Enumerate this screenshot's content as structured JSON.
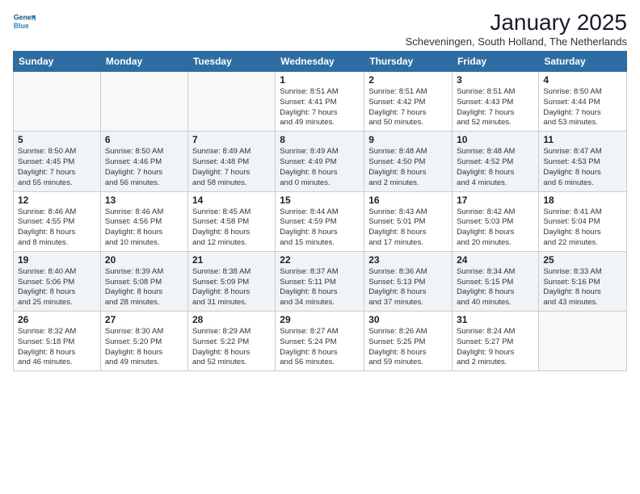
{
  "header": {
    "title": "January 2025",
    "subtitle": "Scheveningen, South Holland, The Netherlands",
    "logo_line1": "General",
    "logo_line2": "Blue"
  },
  "weekdays": [
    "Sunday",
    "Monday",
    "Tuesday",
    "Wednesday",
    "Thursday",
    "Friday",
    "Saturday"
  ],
  "weeks": [
    [
      {
        "day": "",
        "info": ""
      },
      {
        "day": "",
        "info": ""
      },
      {
        "day": "",
        "info": ""
      },
      {
        "day": "1",
        "info": "Sunrise: 8:51 AM\nSunset: 4:41 PM\nDaylight: 7 hours\nand 49 minutes."
      },
      {
        "day": "2",
        "info": "Sunrise: 8:51 AM\nSunset: 4:42 PM\nDaylight: 7 hours\nand 50 minutes."
      },
      {
        "day": "3",
        "info": "Sunrise: 8:51 AM\nSunset: 4:43 PM\nDaylight: 7 hours\nand 52 minutes."
      },
      {
        "day": "4",
        "info": "Sunrise: 8:50 AM\nSunset: 4:44 PM\nDaylight: 7 hours\nand 53 minutes."
      }
    ],
    [
      {
        "day": "5",
        "info": "Sunrise: 8:50 AM\nSunset: 4:45 PM\nDaylight: 7 hours\nand 55 minutes."
      },
      {
        "day": "6",
        "info": "Sunrise: 8:50 AM\nSunset: 4:46 PM\nDaylight: 7 hours\nand 56 minutes."
      },
      {
        "day": "7",
        "info": "Sunrise: 8:49 AM\nSunset: 4:48 PM\nDaylight: 7 hours\nand 58 minutes."
      },
      {
        "day": "8",
        "info": "Sunrise: 8:49 AM\nSunset: 4:49 PM\nDaylight: 8 hours\nand 0 minutes."
      },
      {
        "day": "9",
        "info": "Sunrise: 8:48 AM\nSunset: 4:50 PM\nDaylight: 8 hours\nand 2 minutes."
      },
      {
        "day": "10",
        "info": "Sunrise: 8:48 AM\nSunset: 4:52 PM\nDaylight: 8 hours\nand 4 minutes."
      },
      {
        "day": "11",
        "info": "Sunrise: 8:47 AM\nSunset: 4:53 PM\nDaylight: 8 hours\nand 6 minutes."
      }
    ],
    [
      {
        "day": "12",
        "info": "Sunrise: 8:46 AM\nSunset: 4:55 PM\nDaylight: 8 hours\nand 8 minutes."
      },
      {
        "day": "13",
        "info": "Sunrise: 8:46 AM\nSunset: 4:56 PM\nDaylight: 8 hours\nand 10 minutes."
      },
      {
        "day": "14",
        "info": "Sunrise: 8:45 AM\nSunset: 4:58 PM\nDaylight: 8 hours\nand 12 minutes."
      },
      {
        "day": "15",
        "info": "Sunrise: 8:44 AM\nSunset: 4:59 PM\nDaylight: 8 hours\nand 15 minutes."
      },
      {
        "day": "16",
        "info": "Sunrise: 8:43 AM\nSunset: 5:01 PM\nDaylight: 8 hours\nand 17 minutes."
      },
      {
        "day": "17",
        "info": "Sunrise: 8:42 AM\nSunset: 5:03 PM\nDaylight: 8 hours\nand 20 minutes."
      },
      {
        "day": "18",
        "info": "Sunrise: 8:41 AM\nSunset: 5:04 PM\nDaylight: 8 hours\nand 22 minutes."
      }
    ],
    [
      {
        "day": "19",
        "info": "Sunrise: 8:40 AM\nSunset: 5:06 PM\nDaylight: 8 hours\nand 25 minutes."
      },
      {
        "day": "20",
        "info": "Sunrise: 8:39 AM\nSunset: 5:08 PM\nDaylight: 8 hours\nand 28 minutes."
      },
      {
        "day": "21",
        "info": "Sunrise: 8:38 AM\nSunset: 5:09 PM\nDaylight: 8 hours\nand 31 minutes."
      },
      {
        "day": "22",
        "info": "Sunrise: 8:37 AM\nSunset: 5:11 PM\nDaylight: 8 hours\nand 34 minutes."
      },
      {
        "day": "23",
        "info": "Sunrise: 8:36 AM\nSunset: 5:13 PM\nDaylight: 8 hours\nand 37 minutes."
      },
      {
        "day": "24",
        "info": "Sunrise: 8:34 AM\nSunset: 5:15 PM\nDaylight: 8 hours\nand 40 minutes."
      },
      {
        "day": "25",
        "info": "Sunrise: 8:33 AM\nSunset: 5:16 PM\nDaylight: 8 hours\nand 43 minutes."
      }
    ],
    [
      {
        "day": "26",
        "info": "Sunrise: 8:32 AM\nSunset: 5:18 PM\nDaylight: 8 hours\nand 46 minutes."
      },
      {
        "day": "27",
        "info": "Sunrise: 8:30 AM\nSunset: 5:20 PM\nDaylight: 8 hours\nand 49 minutes."
      },
      {
        "day": "28",
        "info": "Sunrise: 8:29 AM\nSunset: 5:22 PM\nDaylight: 8 hours\nand 52 minutes."
      },
      {
        "day": "29",
        "info": "Sunrise: 8:27 AM\nSunset: 5:24 PM\nDaylight: 8 hours\nand 56 minutes."
      },
      {
        "day": "30",
        "info": "Sunrise: 8:26 AM\nSunset: 5:25 PM\nDaylight: 8 hours\nand 59 minutes."
      },
      {
        "day": "31",
        "info": "Sunrise: 8:24 AM\nSunset: 5:27 PM\nDaylight: 9 hours\nand 2 minutes."
      },
      {
        "day": "",
        "info": ""
      }
    ]
  ]
}
